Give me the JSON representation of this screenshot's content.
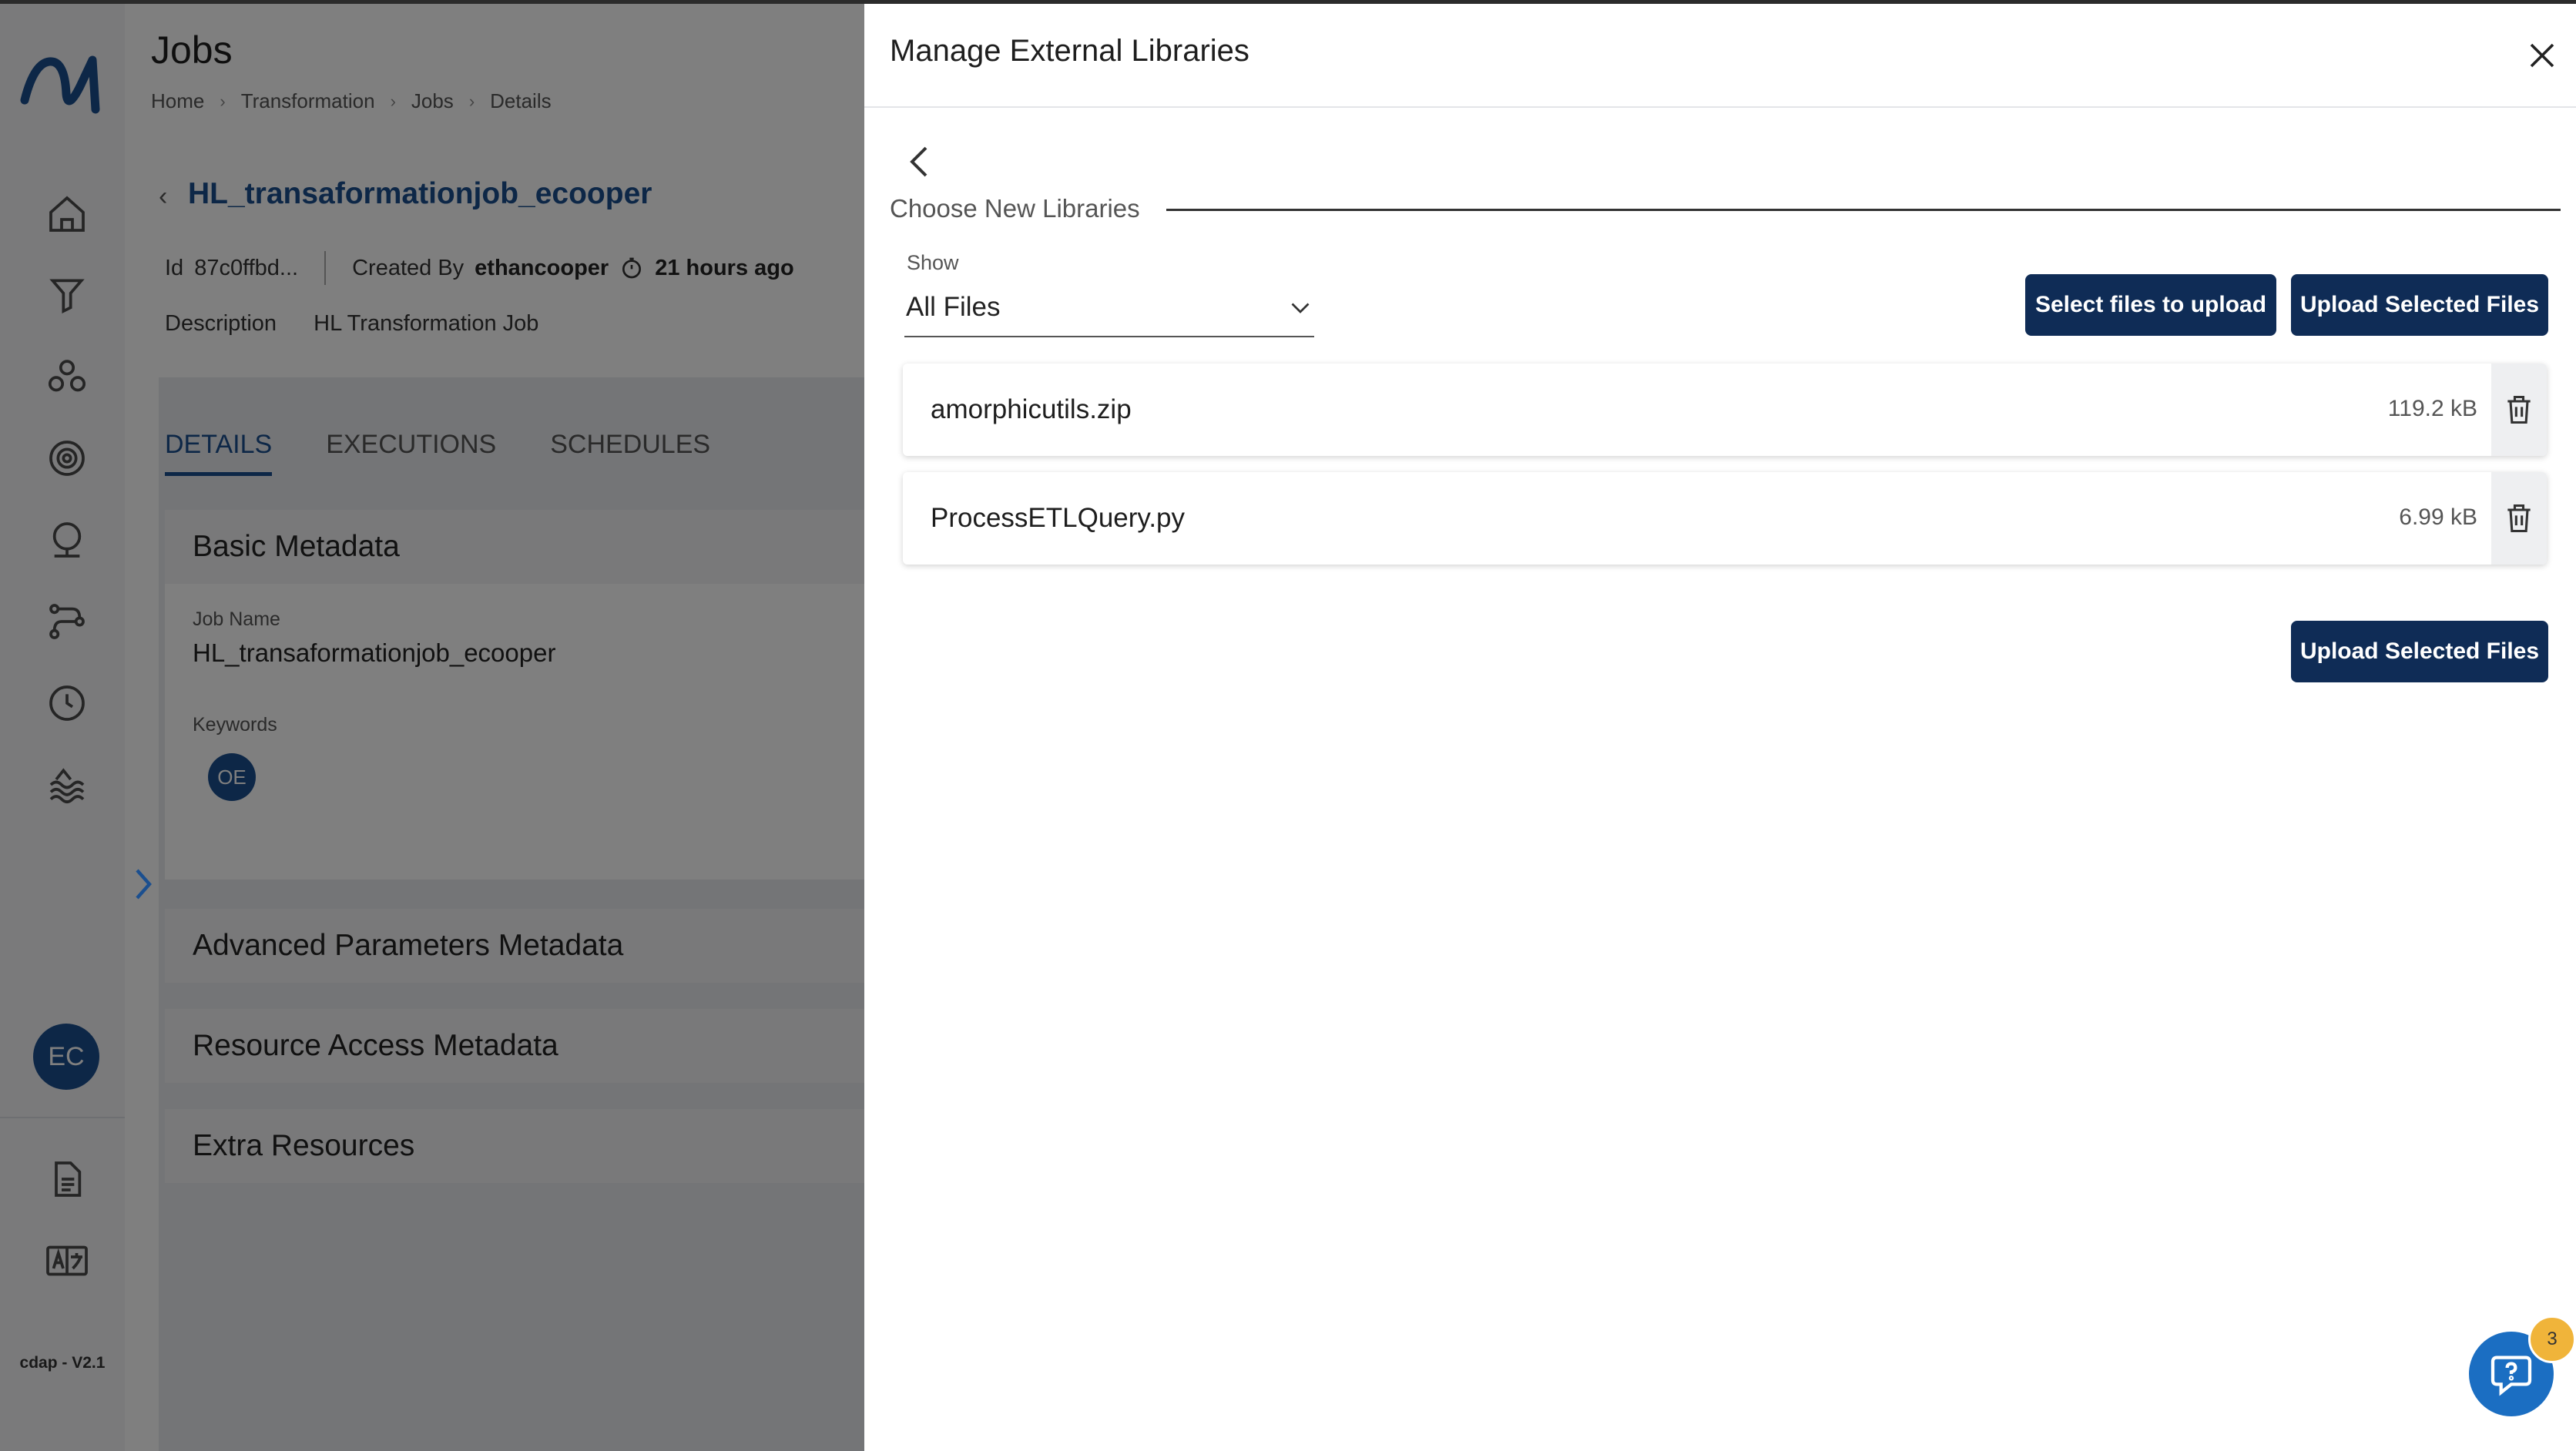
{
  "app": {
    "version": "cdap - V2.1",
    "user_initials": "EC"
  },
  "page": {
    "title": "Jobs",
    "breadcrumbs": [
      "Home",
      "Transformation",
      "Jobs",
      "Details"
    ],
    "job": {
      "name": "HL_transaformationjob_ecooper",
      "id_label": "Id",
      "id_value": "87c0ffbd...",
      "created_by_label": "Created By",
      "created_by": "ethancooper",
      "created_ago": "21 hours ago",
      "description_label": "Description",
      "description": "HL Transformation Job"
    },
    "tabs": [
      {
        "label": "DETAILS",
        "active": true
      },
      {
        "label": "EXECUTIONS",
        "active": false
      },
      {
        "label": "SCHEDULES",
        "active": false
      }
    ],
    "basic_metadata": {
      "title": "Basic Metadata",
      "job_name_label": "Job Name",
      "job_name": "HL_transaformationjob_ecooper",
      "keywords_label": "Keywords",
      "keywords": [
        "OE"
      ]
    },
    "sections": [
      "Advanced Parameters Metadata",
      "Resource Access Metadata",
      "Extra Resources"
    ]
  },
  "drawer": {
    "title": "Manage External Libraries",
    "section_label": "Choose New Libraries",
    "show_label": "Show",
    "show_value": "All Files",
    "select_files_button": "Select files to upload",
    "upload_button": "Upload Selected Files",
    "files": [
      {
        "name": "amorphicutils.zip",
        "size": "119.2 kB"
      },
      {
        "name": "ProcessETLQuery.py",
        "size": "6.99 kB"
      }
    ]
  },
  "help": {
    "badge_count": "3"
  },
  "colors": {
    "primary": "#0f2c56",
    "accent": "#1b4f8f",
    "badge": "#f0b43a"
  },
  "icons": [
    "logo-icon",
    "home-icon",
    "ingestion-icon",
    "groups-icon",
    "settings-icon",
    "explore-icon",
    "pipeline-icon",
    "schedule-icon",
    "lake-icon",
    "docs-icon",
    "translate-icon",
    "close-icon",
    "back-icon",
    "chevron-down-icon",
    "trash-icon",
    "help-icon"
  ]
}
